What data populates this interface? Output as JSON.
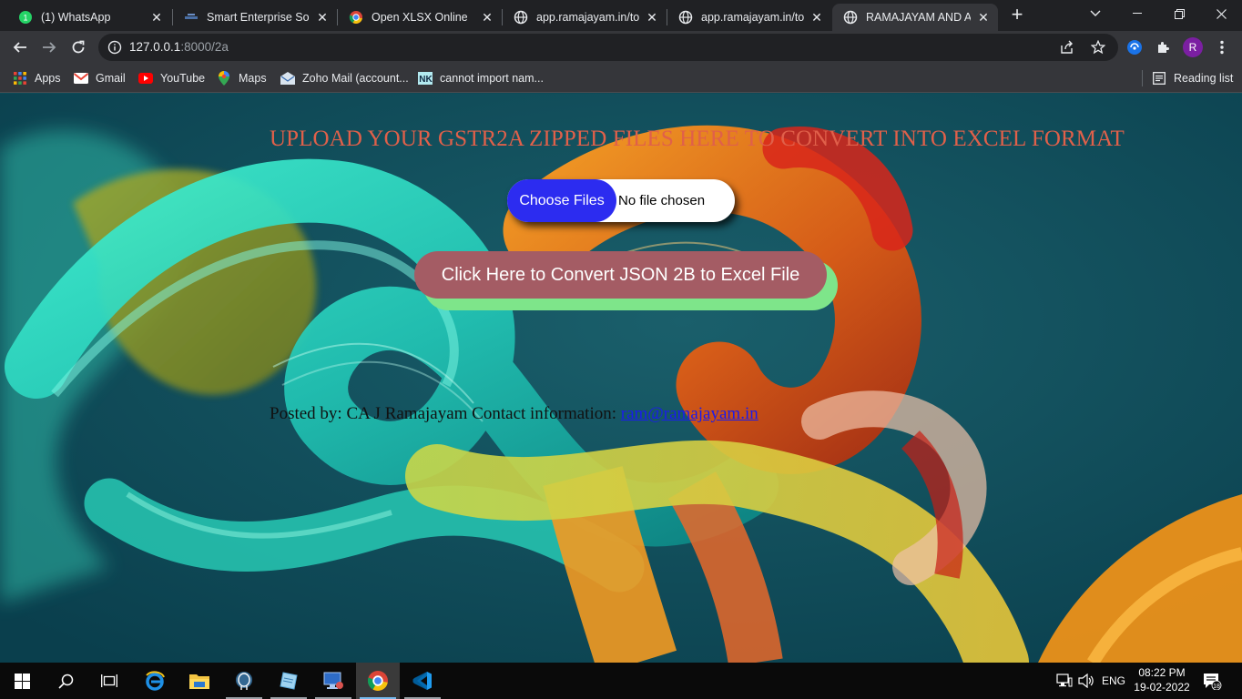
{
  "tabs": [
    {
      "title": "(1) WhatsApp",
      "icon": "whatsapp-icon"
    },
    {
      "title": "Smart Enterprise Solut",
      "icon": "smart-enterprise-icon"
    },
    {
      "title": "Open XLSX Online",
      "icon": "chrome-icon"
    },
    {
      "title": "app.ramajayam.in/tod",
      "icon": "globe-icon"
    },
    {
      "title": "app.ramajayam.in/tod",
      "icon": "globe-icon"
    },
    {
      "title": "RAMAJAYAM AND AS",
      "icon": "globe-icon",
      "active": true
    }
  ],
  "address_bar": {
    "host": "127.0.0.1",
    "path": ":8000/2a"
  },
  "profile_initial": "R",
  "bookmarks": [
    {
      "label": "Apps",
      "icon": "apps-grid-icon"
    },
    {
      "label": "Gmail",
      "icon": "gmail-icon"
    },
    {
      "label": "YouTube",
      "icon": "youtube-icon"
    },
    {
      "label": "Maps",
      "icon": "maps-icon"
    },
    {
      "label": "Zoho Mail (account...",
      "icon": "zoho-mail-icon"
    },
    {
      "label": "cannot import nam...",
      "icon": "nk-icon"
    }
  ],
  "reading_list_label": "Reading list",
  "page": {
    "heading": "UPLOAD YOUR GSTR2A ZIPPED FILES HERE TO CONVERT INTO EXCEL FORMAT",
    "choose_files_label": "Choose Files",
    "no_file_text": "No file chosen",
    "convert_label": "Click Here to Convert JSON 2B to Excel File",
    "posted_text": "Posted by: CA J Ramajayam Contact information: ",
    "contact_email": "ram@ramajayam.in"
  },
  "taskbar": {
    "language": "ENG",
    "time": "08:22 PM",
    "date": "19-02-2022",
    "notification_count": "18"
  },
  "colors": {
    "heading": "#e0604a",
    "choose_button": "#2c2cf0",
    "convert_button": "#a45c64",
    "convert_shadow": "#7ee58a",
    "page_background": "#0d4756"
  }
}
